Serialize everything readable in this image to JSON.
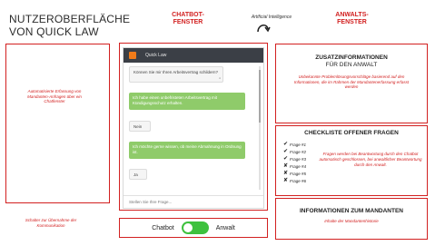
{
  "title": "Nutzeroberfläche von Quick Law",
  "labels": {
    "chatbot": "Chatbot-Fenster",
    "anwalts": "Anwalts-Fenster",
    "ai": "Artificial Intelligence"
  },
  "annotations": {
    "left": "Automatisierte Erfassung von Mandanten-Anfragen über ein Chatfenster",
    "bottom": "Schalter zur Übernahme der Kommunikation"
  },
  "chat": {
    "title": "Quick Law",
    "messages": [
      {
        "from": "bot",
        "text": "Können Sie mir Ihren Arbeitsvertrag schildern?"
      },
      {
        "from": "user",
        "text": "Ich habe einen unbefristeten Arbeitsvertrag mit Kündigungsschutz erhalten."
      },
      {
        "from": "bot",
        "text": "Nein"
      },
      {
        "from": "user",
        "text": "Ich möchte gerne wissen, ob meine Abmahnung in Ordnung ist."
      },
      {
        "from": "bot",
        "text": "Ja"
      }
    ],
    "input_placeholder": "Stellen Sie Ihre Frage..."
  },
  "toggle": {
    "left_label": "Chatbot",
    "right_label": "Anwalt",
    "state": "chatbot"
  },
  "panels": {
    "zusatz": {
      "head": "Zusatzinformationen",
      "sub": "für den Anwalt",
      "note": "Unbekannte Problemlösungsvorschläge basierend auf den Informationen, die im Rahmen der Mandantenerfassung erfasst werden"
    },
    "checkliste": {
      "head": "Checkliste offener Fragen",
      "items": [
        {
          "mark": "✔",
          "label": "Frage #1"
        },
        {
          "mark": "✔",
          "label": "Frage #2"
        },
        {
          "mark": "✔",
          "label": "Frage #3"
        },
        {
          "mark": "✘",
          "label": "Frage #4"
        },
        {
          "mark": "✘",
          "label": "Frage #5"
        },
        {
          "mark": "✘",
          "label": "Frage #6"
        }
      ],
      "note": "Fragen werden bei Beantwortung durch den Chatbot automatisch geschlossen, bei anwaltlicher Beantwortung durch den Anwalt."
    },
    "mandant": {
      "head": "Informationen zum Mandanten",
      "note": "Inhalte der Mandantenhistorie"
    }
  },
  "colors": {
    "accent_red": "#d22020",
    "user_bubble": "#8fcb6a",
    "chat_header": "#3b3f46",
    "toggle_on": "#3ec13e",
    "bot_icon": "#f07b19"
  }
}
